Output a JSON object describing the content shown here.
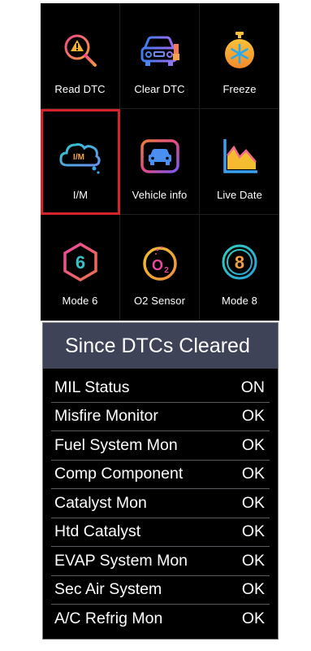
{
  "menu": {
    "items": [
      {
        "label": "Read DTC",
        "icon": "read-dtc-icon"
      },
      {
        "label": "Clear DTC",
        "icon": "clear-dtc-icon"
      },
      {
        "label": "Freeze",
        "icon": "freeze-icon"
      },
      {
        "label": "I/M",
        "icon": "im-icon",
        "icon_text": "I/M",
        "selected": true
      },
      {
        "label": "Vehicle info",
        "icon": "vehicle-info-icon"
      },
      {
        "label": "Live Date",
        "icon": "live-data-icon"
      },
      {
        "label": "Mode 6",
        "icon": "mode-6-icon",
        "icon_text": "6"
      },
      {
        "label": "O2 Sensor",
        "icon": "o2-sensor-icon",
        "icon_text": "O",
        "icon_sub": "2"
      },
      {
        "label": "Mode 8",
        "icon": "mode-8-icon",
        "icon_text": "8"
      }
    ]
  },
  "panel": {
    "title": "Since DTCs Cleared",
    "rows": [
      {
        "name": "MIL Status",
        "value": "ON"
      },
      {
        "name": "Misfire Monitor",
        "value": "OK"
      },
      {
        "name": "Fuel System Mon",
        "value": "OK"
      },
      {
        "name": "Comp Component",
        "value": "OK"
      },
      {
        "name": "Catalyst Mon",
        "value": "OK"
      },
      {
        "name": "Htd Catalyst",
        "value": "OK"
      },
      {
        "name": "EVAP System Mon",
        "value": "OK"
      },
      {
        "name": "Sec Air System",
        "value": "OK"
      },
      {
        "name": "A/C Refrig Mon",
        "value": "OK"
      }
    ]
  },
  "colors": {
    "selection": "#d5232b",
    "header_bg": "#3e4357",
    "screen_bg": "#000000"
  }
}
